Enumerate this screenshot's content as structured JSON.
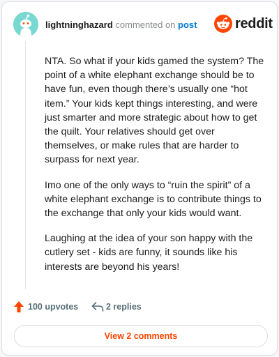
{
  "header": {
    "author": "lightninghazard",
    "action_text": "commented on",
    "post_link": "post",
    "brand_name": "reddit",
    "brand_color": "#ff4500",
    "avatar_color": "#79d8d0",
    "avatar_icon": "snoo-avatar-icon"
  },
  "comment": {
    "paragraphs": [
      "NTA. So what if your kids gamed the system? The point of a white elephant exchange should be to have fun, even though there’s usually one “hot item.” Your kids kept things interesting, and were just smarter and more strategic about how to get the quilt. Your relatives should get over themselves, or make rules that are harder to surpass for next year.",
      "Imo one of the only ways to “ruin the spirit” of a white elephant exchange is to contribute things to the exchange that only your kids would want.",
      "Laughing at the idea of your son happy with the cutlery set - kids are funny, it sounds like his interests are beyond his years!"
    ]
  },
  "actions": {
    "upvotes": "100 upvotes",
    "replies": "2 replies",
    "upvote_icon": "upvote-arrow-icon",
    "reply_icon": "reply-arrow-icon",
    "upvote_color": "#ff4500"
  },
  "footer": {
    "view_comments": "View 2 comments"
  }
}
